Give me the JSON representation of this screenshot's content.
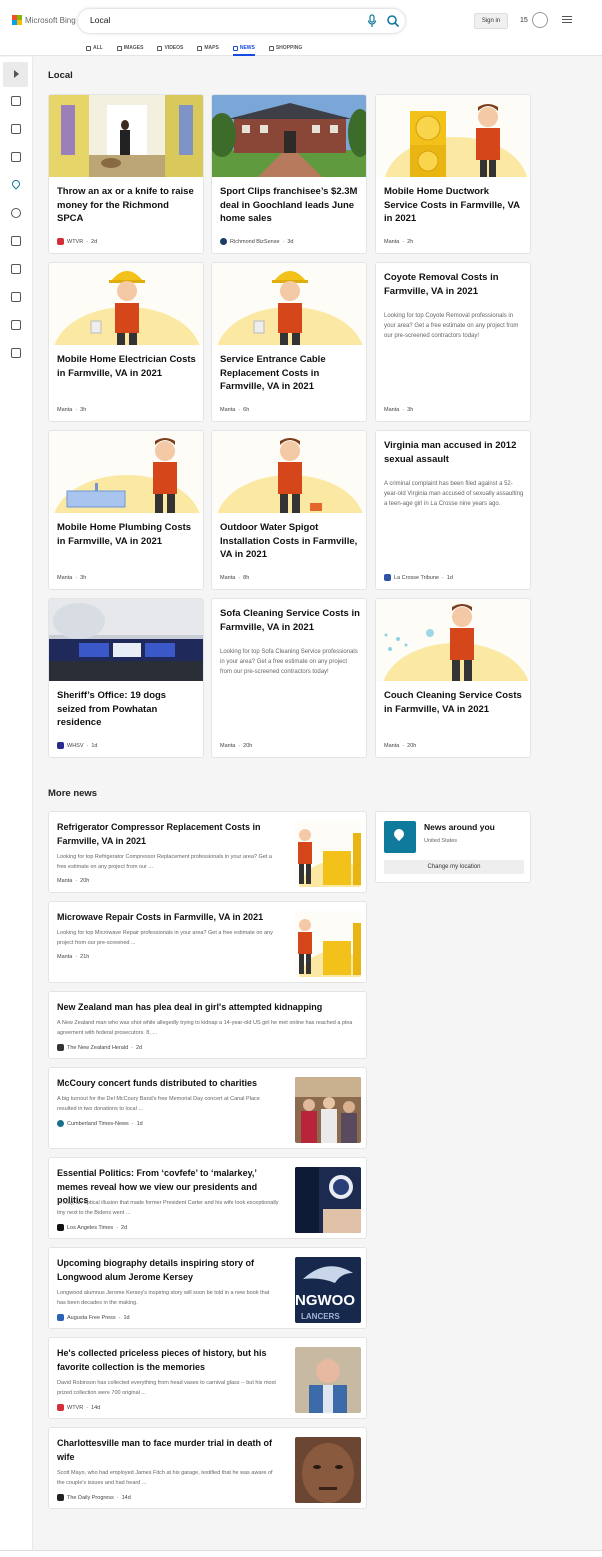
{
  "header": {
    "logo_text": "Microsoft Bing",
    "search_value": "Local",
    "signin_label": "Sign in",
    "points": "15",
    "nav": [
      {
        "label": "ALL"
      },
      {
        "label": "IMAGES"
      },
      {
        "label": "VIDEOS"
      },
      {
        "label": "MAPS"
      },
      {
        "label": "NEWS"
      },
      {
        "label": "SHOPPING"
      }
    ],
    "active_nav": "NEWS"
  },
  "sections": {
    "local_title": "Local",
    "more_news_title": "More news"
  },
  "local_cards": [
    {
      "title": "Throw an ax or a knife to raise money for the Richmond SPCA",
      "desc": "",
      "source": "WTVR",
      "age": "2d",
      "image": "hallway-photo"
    },
    {
      "title": "Sport Clips franchisee’s $2.3M deal in Goochland leads June home sales",
      "desc": "",
      "source": "Richmond BizSense",
      "age": "3d",
      "image": "house-photo"
    },
    {
      "title": "Mobile Home Ductwork Service Costs in Farmville, VA in 2021",
      "desc": "",
      "source": "Manta",
      "age": "2h",
      "image": "duct-illustration"
    },
    {
      "title": "Mobile Home Electrician Costs in Farmville, VA in 2021",
      "desc": "",
      "source": "Manta",
      "age": "3h",
      "image": "electrician-illustration"
    },
    {
      "title": "Service Entrance Cable Replacement Costs in Farmville, VA in 2021",
      "desc": "",
      "source": "Manta",
      "age": "6h",
      "image": "electrician-illustration"
    },
    {
      "title": "Coyote Removal Costs in Farmville, VA in 2021",
      "desc": "Looking for top Coyote Removal professionals in your area? Get a free estimate on any project from our pre-screened contractors today!",
      "source": "Manta",
      "age": "3h",
      "image": ""
    },
    {
      "title": "Mobile Home Plumbing Costs in Farmville, VA in 2021",
      "desc": "",
      "source": "Manta",
      "age": "3h",
      "image": "plumber-illustration"
    },
    {
      "title": "Outdoor Water Spigot Installation Costs in Farmville, VA in 2021",
      "desc": "",
      "source": "Manta",
      "age": "8h",
      "image": "plumber-illustration"
    },
    {
      "title": "Virginia man accused in 2012 sexual assault",
      "desc": "A criminal complaint has been filed against a 52-year-old Virginia man accused of sexually assaulting a teen-age girl in La Crosse nine years ago.",
      "source": "La Crosse Tribune",
      "age": "1d",
      "image": ""
    },
    {
      "title": "Sheriff’s Office: 19 dogs seized from Powhatan residence",
      "desc": "",
      "source": "WHSV",
      "age": "1d",
      "image": "police-light-photo"
    },
    {
      "title": "Sofa Cleaning Service Costs in Farmville, VA in 2021",
      "desc": "Looking for top Sofa Cleaning Service professionals in your area? Get a free estimate on any project from our pre-screened contractors today!",
      "source": "Manta",
      "age": "20h",
      "image": ""
    },
    {
      "title": "Couch Cleaning Service Costs in Farmville, VA in 2021",
      "desc": "",
      "source": "Manta",
      "age": "20h",
      "image": "cleaner-illustration"
    }
  ],
  "more_news": [
    {
      "title": "Refrigerator Compressor Replacement Costs in Farmville, VA in 2021",
      "desc": "Looking for top Refrigerator Compressor Replacement professionals in your area? Get a free estimate on any project from our ...",
      "source": "Manta",
      "age": "20h"
    },
    {
      "title": "Microwave Repair Costs in Farmville, VA in 2021",
      "desc": "Looking for top Microwave Repair professionals in your area? Get a free estimate on any project from our pre-screened ...",
      "source": "Manta",
      "age": "21h"
    },
    {
      "title": "New Zealand man has plea deal in girl's attempted kidnapping",
      "desc": "A New Zealand man who was shot while allegedly trying to kidnap a 14-year-old US girl he met online has reached a plea agreement with federal prosecutors. 8, ...",
      "source": "The New Zealand Herald",
      "age": "2d"
    },
    {
      "title": "McCoury concert funds distributed to charities",
      "desc": "A big turnout for the Del McCoury Band's free Memorial Day concert at Canal Place resulted in two donations to local ...",
      "source": "Cumberland Times-News",
      "age": "1d"
    },
    {
      "title": "Essential Politics: From ‘covfefe’ to ‘malarkey,’ memes reveal how we view our presidents and politics",
      "desc": "In May, an optical illusion that made former President Carter and his wife look exceptionally tiny next to the Bidens went ...",
      "source": "Los Angeles Times",
      "age": "2d"
    },
    {
      "title": "Upcoming biography details inspiring story of Longwood alum Jerome Kersey",
      "desc": "Longwood alumnus Jerome Kersey's inspiring story will soon be told in a new book that has been decades in the making.",
      "source": "Augusta Free Press",
      "age": "1d"
    },
    {
      "title": "He's collected priceless pieces of history, but his favorite collection is the memories",
      "desc": "David Robinson has collected everything from head vases to carnival glass -- but his most prized collection were 700 original ...",
      "source": "WTVR",
      "age": "14d"
    },
    {
      "title": "Charlottesville man to face murder trial in death of wife",
      "desc": "Scott Mayo, who had employed James Fitch at his garage, testified that he was aware of the couple's issues and had heard ...",
      "source": "The Daily Progress",
      "age": "14d"
    }
  ],
  "news_around": {
    "title": "News around you",
    "location": "United States",
    "button": "Change my location"
  },
  "colors": {
    "accent": "#174ae4",
    "teal": "#0f7a9c",
    "illustration_yellow": "#fbe9a3",
    "shirt": "#d6461b"
  }
}
